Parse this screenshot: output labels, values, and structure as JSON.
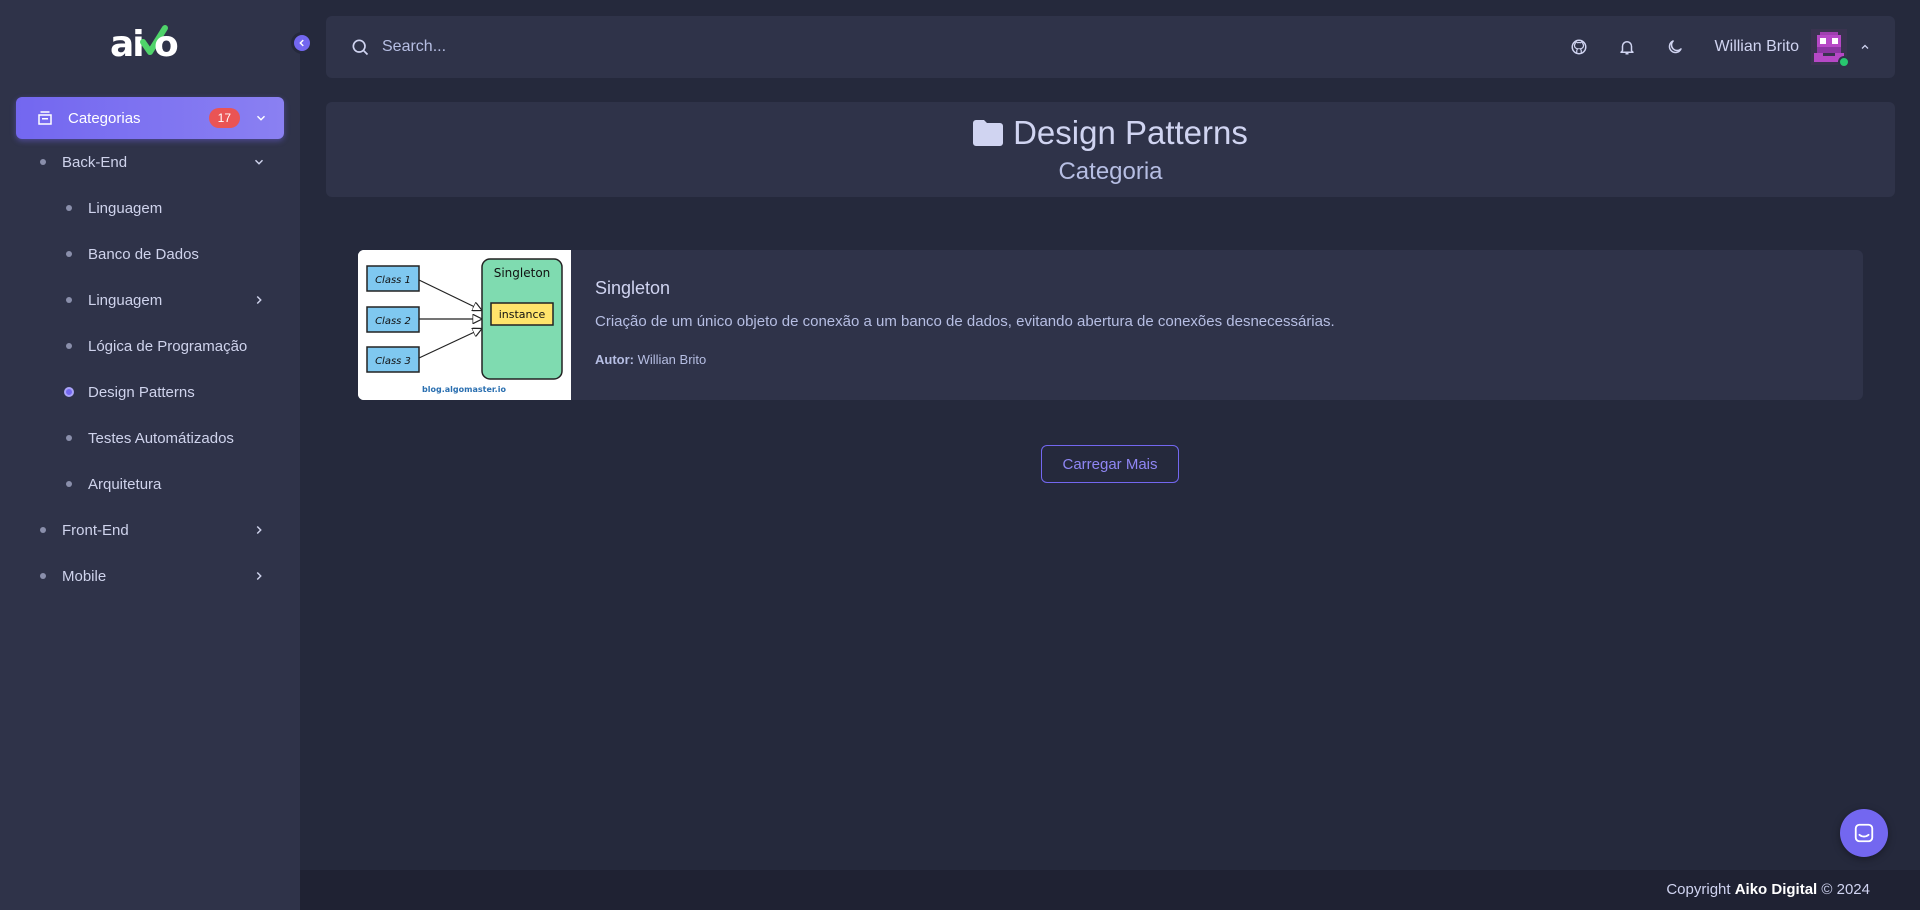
{
  "brand": {
    "logo_text": "aiko"
  },
  "search": {
    "placeholder": "Search..."
  },
  "user": {
    "name": "Willian Brito"
  },
  "sidebar": {
    "top": {
      "label": "Categorias",
      "badge": "17"
    },
    "items": [
      {
        "label": "Back-End"
      },
      {
        "label": "Linguagem"
      },
      {
        "label": "Banco de Dados"
      },
      {
        "label": "Linguagem"
      },
      {
        "label": "Lógica de Programação"
      },
      {
        "label": "Design Patterns"
      },
      {
        "label": "Testes Automátizados"
      },
      {
        "label": "Arquitetura"
      },
      {
        "label": "Front-End"
      },
      {
        "label": "Mobile"
      }
    ]
  },
  "header": {
    "title": "Design Patterns",
    "subtitle": "Categoria"
  },
  "post": {
    "title": "Singleton",
    "description": "Criação de um único objeto de conexão a um banco de dados, evitando abertura de conexões desnecessárias.",
    "author_label": "Autor:",
    "author": "Willian Brito",
    "thumb": {
      "class1": "Class 1",
      "class2": "Class 2",
      "class3": "Class 3",
      "singleton": "Singleton",
      "instance": "instance",
      "source": "blog.algomaster.io"
    }
  },
  "actions": {
    "load_more": "Carregar Mais"
  },
  "footer": {
    "prefix": "Copyright",
    "company": "Aiko Digital",
    "suffix": "© 2024"
  },
  "colors": {
    "accent": "#7367f0",
    "badge": "#ea5455",
    "online": "#28c76f"
  },
  "icons": [
    "search-icon",
    "github-icon",
    "bell-icon",
    "moon-icon",
    "chevron-up-icon",
    "chevron-left-icon",
    "stack-icon",
    "chevron-down-icon",
    "chevron-right-icon",
    "folder-icon",
    "chat-icon"
  ]
}
